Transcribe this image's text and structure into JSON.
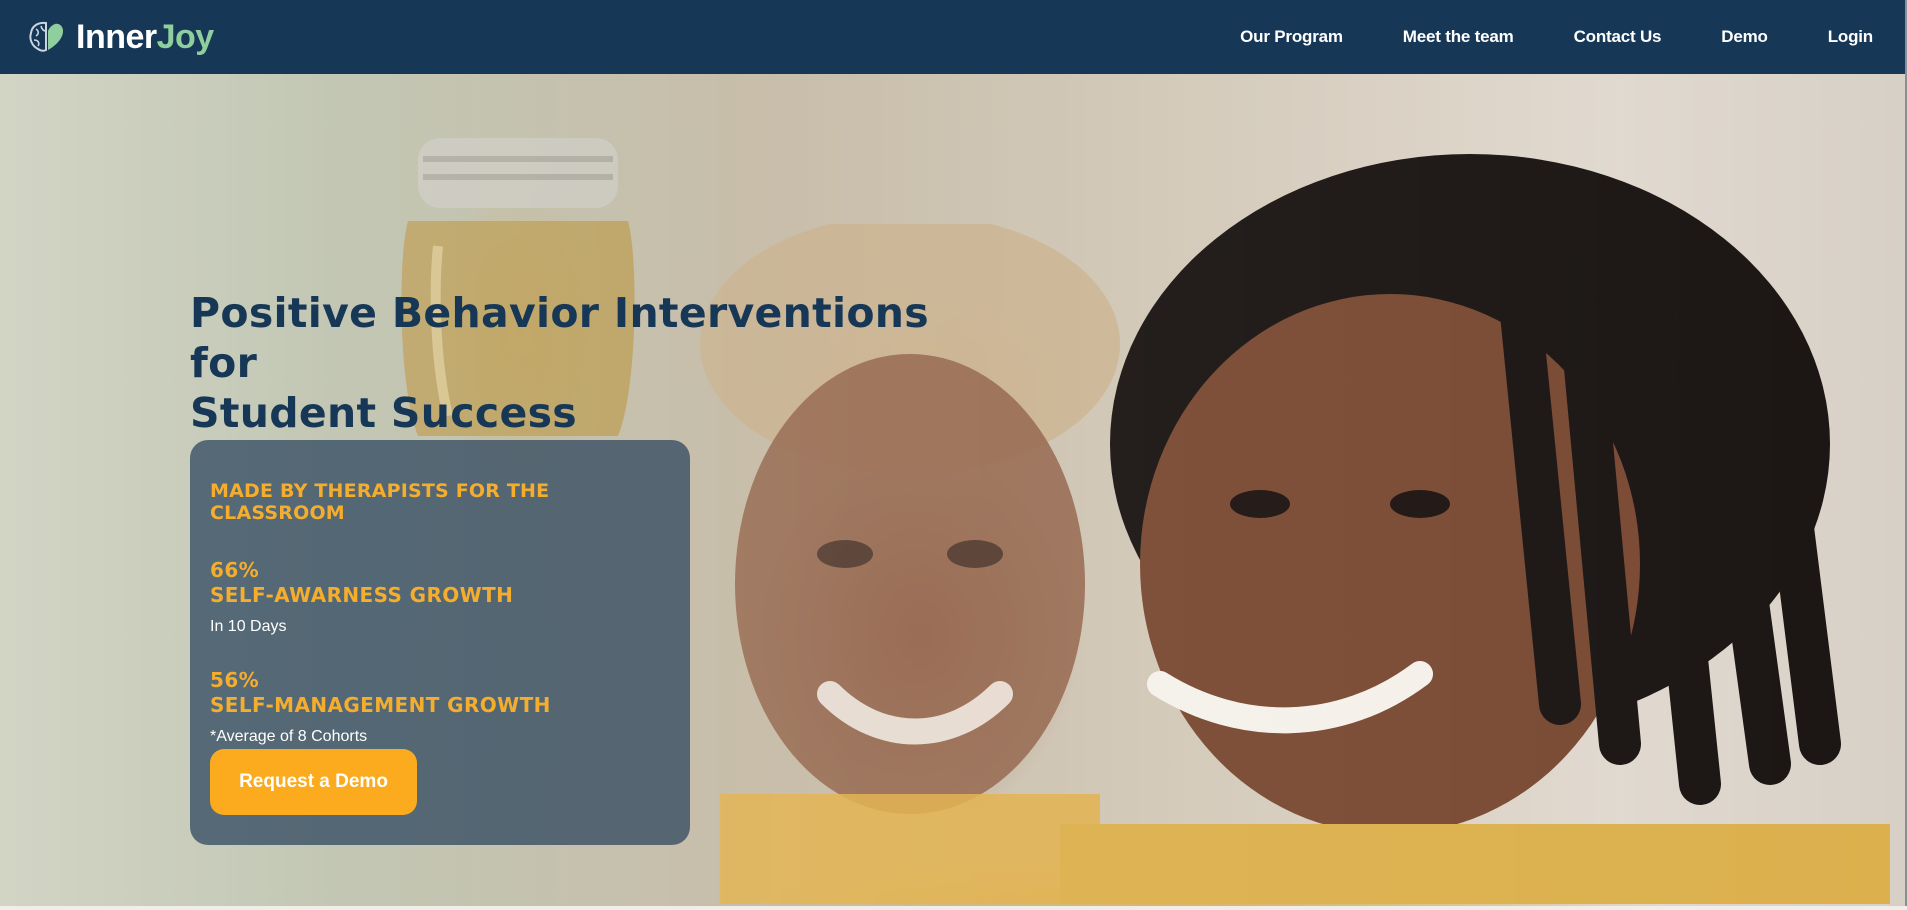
{
  "brand": {
    "name_part1": "Inner",
    "name_part2": "Joy",
    "logo_icon": "brain-heart-icon",
    "colors": {
      "navy": "#173756",
      "green": "#8fcf9d",
      "accent": "#f4ad2d",
      "button": "#fbab1d"
    }
  },
  "nav": {
    "items": [
      {
        "label": "Our Program"
      },
      {
        "label": "Meet the team"
      },
      {
        "label": "Contact Us"
      },
      {
        "label": "Demo"
      },
      {
        "label": "Login"
      }
    ]
  },
  "hero": {
    "headline_line1": "Positive Behavior Interventions for",
    "headline_line2": "Student Success",
    "panel": {
      "tagline": "MADE BY THERAPISTS FOR THE CLASSROOM",
      "stats": [
        {
          "value": "66%",
          "label": "SELF-AWARNESS GROWTH",
          "note": "In 10 Days"
        },
        {
          "value": "56%",
          "label": "SELF-MANAGEMENT GROWTH",
          "note": "*Average of 8 Cohorts"
        }
      ],
      "cta_label": "Request a Demo"
    }
  }
}
